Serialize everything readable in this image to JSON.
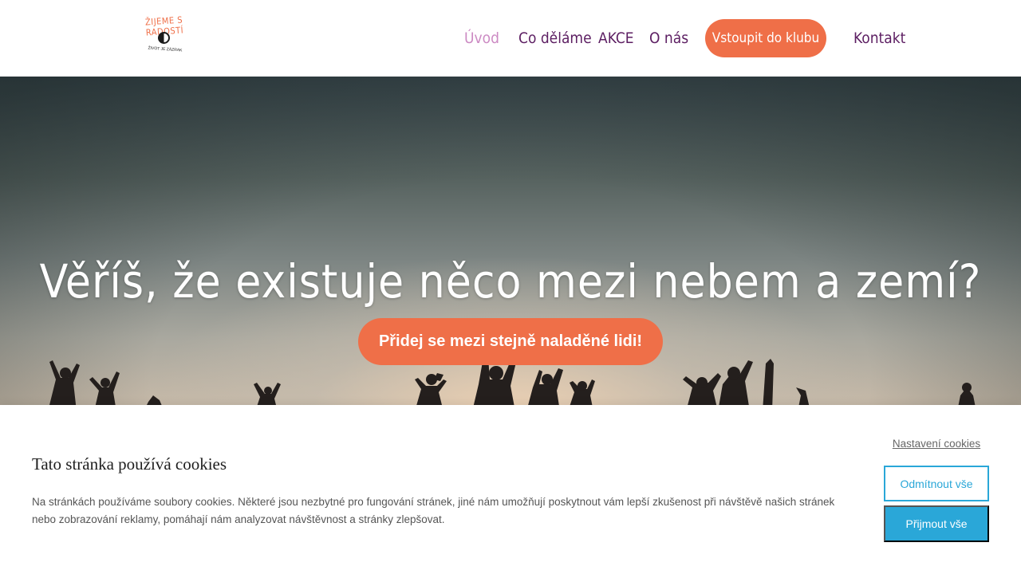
{
  "header": {
    "logo": {
      "title": "ŽIJEME S RADOSTÍ",
      "motto": "ŽIVOT JE ZÁZRAK"
    },
    "nav": {
      "uvod": "Úvod",
      "co_delame": "Co děláme",
      "akce": "AKCE",
      "o_nas": "O nás",
      "cta": "Vstoupit do klubu",
      "kontakt": "Kontakt"
    }
  },
  "hero": {
    "title": "Věříš, že existuje něco mezi nebem a zemí?",
    "cta": "Přidej se mezi stejně naladěné lidi!"
  },
  "cookies": {
    "title": "Tato stránka používá cookies",
    "text": "Na stránkách používáme soubory cookies. Některé jsou nezbytné pro fungování stránek, jiné nám umožňují poskytnout vám lepší zkušenost při návštěvě našich stránek nebo zobrazování reklamy, pomáhají nám analyzovat návštěvnost a stránky zlepšovat.",
    "settings": "Nastavení cookies",
    "reject": "Odmítnout vše",
    "accept": "Přijmout vše"
  },
  "colors": {
    "accent": "#ef6f48",
    "nav_text": "#5c1e62",
    "nav_active": "#cc8ac3",
    "cookie_button": "#2aa7d8"
  }
}
